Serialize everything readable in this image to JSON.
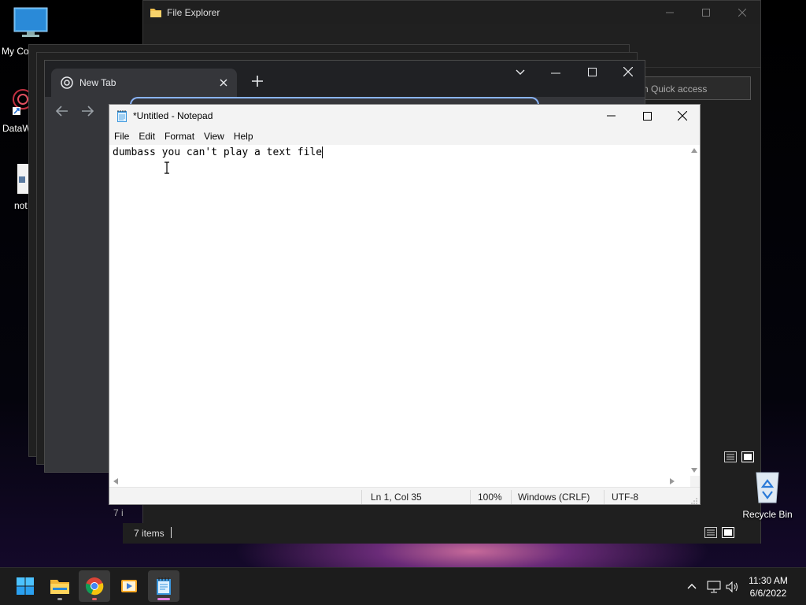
{
  "desktop": {
    "icons": [
      {
        "label": "My Co"
      },
      {
        "label": "DataW"
      },
      {
        "label": "not"
      },
      {
        "label": "Recycle Bin"
      }
    ]
  },
  "explorer": {
    "title": "File Explorer",
    "search_placeholder": "h Quick access",
    "status_items": "7 items",
    "status_fragment": "7 i"
  },
  "chrome": {
    "tab_title": "New Tab"
  },
  "notepad": {
    "title": "*Untitled - Notepad",
    "menu": [
      "File",
      "Edit",
      "Format",
      "View",
      "Help"
    ],
    "content": "dumbass you can't play a text file",
    "status": {
      "position": "Ln 1, Col 35",
      "zoom": "100%",
      "line_ending": "Windows (CRLF)",
      "encoding": "UTF-8"
    }
  },
  "taskbar": {
    "time": "11:30 AM",
    "date": "6/6/2022"
  },
  "colors": {
    "accent": "#0078d4",
    "chrome_tab": "#35363a",
    "taskbar": "#1c1c1c"
  }
}
